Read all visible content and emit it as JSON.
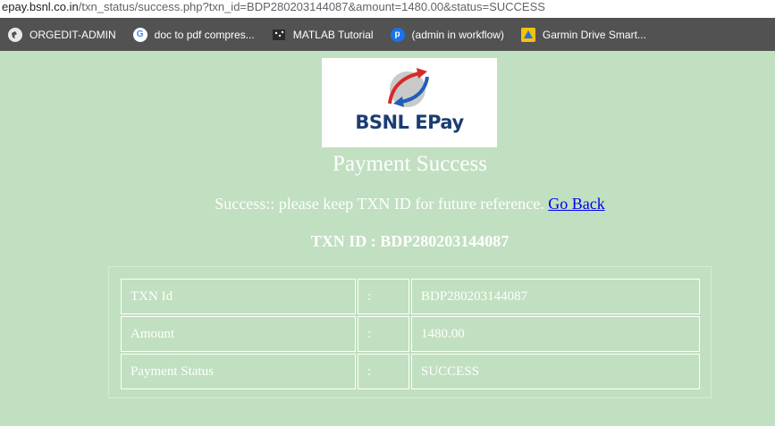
{
  "browser": {
    "url_host": "epay.bsnl.co.in",
    "url_path": "/txn_status/success.php?txn_id=BDP280203144087&amount=1480.00&status=SUCCESS",
    "bookmarks": [
      {
        "label": "ORGEDIT-ADMIN",
        "icon": "globe-icon"
      },
      {
        "label": "doc to pdf compres...",
        "icon": "google-icon"
      },
      {
        "label": "MATLAB Tutorial",
        "icon": "matlab-icon"
      },
      {
        "label": "(admin in workflow)",
        "icon": "p-app-icon"
      },
      {
        "label": "Garmin Drive Smart...",
        "icon": "garmin-icon"
      }
    ]
  },
  "logo": {
    "text": "BSNL EPay",
    "text_color": "#1b3d72"
  },
  "page": {
    "title": "Payment Success",
    "message": "Success:: please keep TXN ID for future reference.",
    "back_link": "Go Back",
    "txn_heading": "TXN ID : BDP280203144087"
  },
  "details": {
    "rows": [
      {
        "label": "TXN Id",
        "sep": ":",
        "value": "BDP280203144087"
      },
      {
        "label": "Amount",
        "sep": ":",
        "value": "1480.00"
      },
      {
        "label": "Payment Status",
        "sep": ":",
        "value": "SUCCESS"
      }
    ]
  },
  "colors": {
    "page_background": "#c1dfc1",
    "bookmark_bar": "#525252",
    "link": "#0000ee"
  }
}
